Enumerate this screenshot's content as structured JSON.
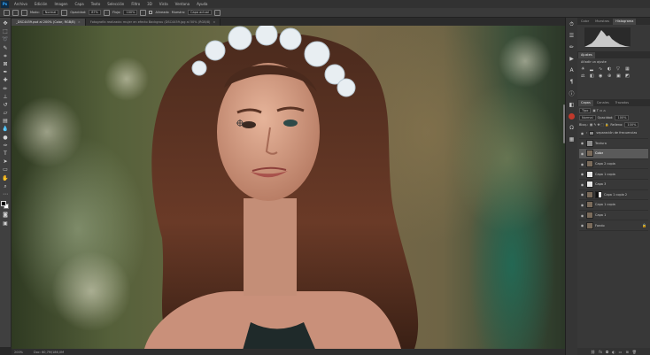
{
  "menu": {
    "logo": "Ps",
    "items": [
      "Archivo",
      "Edición",
      "Imagen",
      "Capa",
      "Texto",
      "Selección",
      "Filtro",
      "3D",
      "Vista",
      "Ventana",
      "Ayuda"
    ]
  },
  "options": {
    "modo_label": "Modo:",
    "modo_value": "Normal",
    "opacidad_label": "Opacidad:",
    "opacidad_value": "87%",
    "flujo_label": "Flujo:",
    "flujo_value": "100%",
    "alineado_label": "Alineado",
    "muestra_label": "Muestra:",
    "muestra_value": "Capa actual"
  },
  "document_tabs": [
    {
      "label": "_DSC4459.psd al 200% (Color, RGB/8)",
      "active": true
    },
    {
      "label": "Fotografía realizada: mujer en efecto Backgrou (DSC4459.jpg al 50% (RGB/8)",
      "active": false
    }
  ],
  "status": {
    "zoom": "200%",
    "doc": "Doc: 60,7M/186,0M"
  },
  "panels": {
    "top_tabs": [
      "Color",
      "Muestras",
      "Histograma"
    ],
    "adjust_tabs": [
      "Ajustes"
    ],
    "adjust_label": "Añadir un ajuste",
    "layer_tabs": [
      "Capas",
      "Canales",
      "Trazados"
    ],
    "kind_label": "Tipo",
    "blend_mode": "Normal",
    "opacity_label": "Opacidad:",
    "opacity_value": "100%",
    "lock_label": "Bloq.:",
    "fill_label": "Relleno:",
    "fill_value": "100%",
    "layers": [
      {
        "name": "separación de frecuencias",
        "type": "group",
        "selected": false
      },
      {
        "name": "Textura",
        "type": "layer",
        "selected": false
      },
      {
        "name": "Color",
        "type": "layer",
        "selected": true
      },
      {
        "name": "Capa 2 copia",
        "type": "layer",
        "selected": false
      },
      {
        "name": "Capa 1 copia",
        "type": "white",
        "selected": false
      },
      {
        "name": "Capa 3",
        "type": "layer",
        "selected": false
      },
      {
        "name": "Capa 1 copia 2",
        "type": "mask",
        "selected": false
      },
      {
        "name": "Capa 1 copia",
        "type": "layer",
        "selected": false
      },
      {
        "name": "Capa 1",
        "type": "layer",
        "selected": false
      },
      {
        "name": "Fondo",
        "type": "layer",
        "selected": false,
        "locked": true
      }
    ]
  }
}
